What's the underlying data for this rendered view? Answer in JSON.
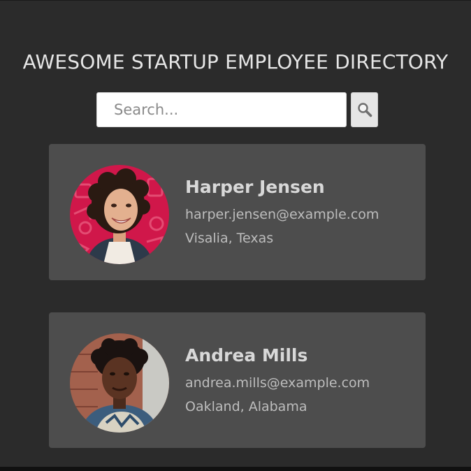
{
  "header": {
    "title": "AWESOME STARTUP EMPLOYEE DIRECTORY"
  },
  "search": {
    "placeholder": "Search...",
    "value": "",
    "button_icon": "search-icon"
  },
  "employees": [
    {
      "name": "Harper Jensen",
      "email": "harper.jensen@example.com",
      "location": "Visalia, Texas",
      "avatar_background": "#d0174a"
    },
    {
      "name": "Andrea Mills",
      "email": "andrea.mills@example.com",
      "location": "Oakland, Alabama",
      "avatar_background": "#8c4a3a"
    }
  ],
  "colors": {
    "background": "#2b2b2b",
    "card": "#4d4d4d",
    "title": "#e6e6e6",
    "text_primary": "#d8d8d8",
    "text_secondary": "#bdbdbd"
  }
}
